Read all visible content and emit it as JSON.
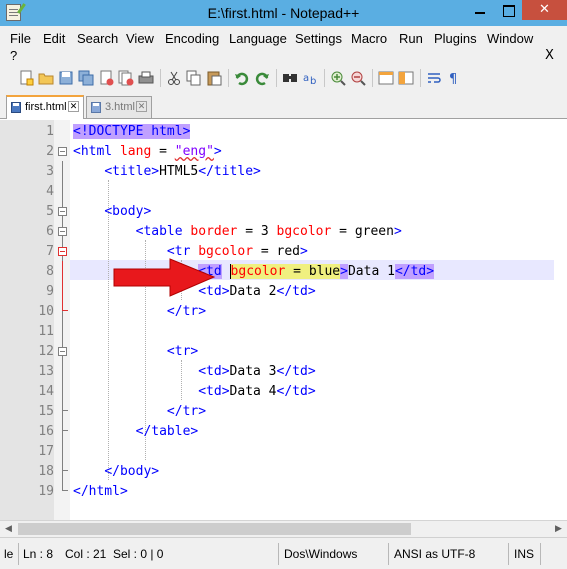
{
  "window": {
    "title": "E:\\first.html - Notepad++",
    "close_glyph": "✕"
  },
  "menubar": {
    "items": [
      "File",
      "Edit",
      "Search",
      "View",
      "Encoding",
      "Language",
      "Settings",
      "Macro",
      "Run",
      "Plugins",
      "Window"
    ],
    "extra": "?",
    "close_glyph": "X"
  },
  "toolbar": {
    "icons": [
      "new-file-icon",
      "open-file-icon",
      "save-icon",
      "save-all-icon",
      "close-icon",
      "close-all-icon",
      "print-icon",
      "cut-icon",
      "copy-icon",
      "paste-icon",
      "undo-icon",
      "redo-icon",
      "find-icon",
      "replace-icon",
      "zoom-in-icon",
      "zoom-out-icon",
      "sync-vertical-icon",
      "sync-horizontal-icon",
      "word-wrap-icon",
      "show-all-chars-icon"
    ]
  },
  "tabs": [
    {
      "label": "first.html",
      "active": true,
      "close_glyph": "✕"
    },
    {
      "label": "3.html",
      "active": false,
      "close_glyph": "✕"
    }
  ],
  "editor": {
    "line_numbers": [
      "1",
      "2",
      "3",
      "4",
      "5",
      "6",
      "7",
      "8",
      "9",
      "10",
      "11",
      "12",
      "13",
      "14",
      "15",
      "16",
      "17",
      "18",
      "19"
    ],
    "line1": {
      "open": "<!DOCTYPE html",
      "close": ">"
    },
    "line2": {
      "open": "<html ",
      "attr": "lang",
      "eq": " = ",
      "val": "\"eng\"",
      "close": ">"
    },
    "line3": {
      "indent": "    ",
      "open": "<title>",
      "text": "HTML5",
      "close": "</title>"
    },
    "line5": {
      "indent": "    ",
      "tag": "<body>"
    },
    "line6": {
      "indent": "        ",
      "open": "<table ",
      "attr1": "border",
      "eq1": " = ",
      "val1": "3",
      "sp": " ",
      "attr2": "bgcolor",
      "eq2": " = ",
      "val2": "green",
      "close": ">"
    },
    "line7": {
      "indent": "            ",
      "open": "<tr ",
      "attr": "bgcolor",
      "eq": " = ",
      "val": "red",
      "close": ">"
    },
    "line8": {
      "indent": "                ",
      "open": "<td",
      "sp": " ",
      "attr": "bgcolor",
      "eq": " = ",
      "val": "blue",
      "close": ">",
      "text": "Data 1",
      "endtag": "</td>"
    },
    "line9": {
      "indent": "                ",
      "open": "<td>",
      "text": "Data 2",
      "close": "</td>"
    },
    "line10": {
      "indent": "            ",
      "tag": "</tr>"
    },
    "line12": {
      "indent": "            ",
      "tag": "<tr>"
    },
    "line13": {
      "indent": "                ",
      "open": "<td>",
      "text": "Data 3",
      "close": "</td>"
    },
    "line14": {
      "indent": "                ",
      "open": "<td>",
      "text": "Data 4",
      "close": "</td>"
    },
    "line15": {
      "indent": "            ",
      "tag": "</tr>"
    },
    "line16": {
      "indent": "        ",
      "tag": "</table>"
    },
    "line18": {
      "indent": "    ",
      "tag": "</body>"
    },
    "line19": {
      "tag": "</html>"
    }
  },
  "statusbar": {
    "cut_text": "le",
    "ln": "Ln : 8",
    "col": "Col : 21",
    "sel": "Sel : 0 | 0",
    "eol": "Dos\\Windows",
    "encoding": "ANSI as UTF-8",
    "mode": "INS"
  },
  "colors": {
    "titlebar": "#5aaee2",
    "close_button": "#c7503e",
    "tag": "#0000ff",
    "attribute": "#ff0000",
    "value": "#8000ff",
    "current_line": "#e8e8ff",
    "annotation_arrow": "#e8181c"
  }
}
